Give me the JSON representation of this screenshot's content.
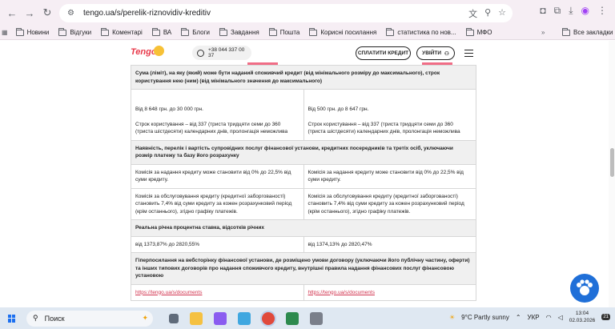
{
  "browser": {
    "url": "tengo.ua/s/perelik-riznovidiv-kreditiv",
    "bookmarks": [
      "Новини",
      "Відгуки",
      "Коментарі",
      "ВА",
      "Блоги",
      "Завдання",
      "Пошта",
      "Корисні посилання",
      "статистика по нов...",
      "МФО"
    ],
    "all_bookmarks": "Все закладки"
  },
  "header": {
    "logo": "Tengo",
    "phone": "+38 044 337 00 37",
    "pay_button": "СПЛАТИТИ КРЕДИТ",
    "login_button": "УВІЙТИ"
  },
  "table": {
    "h1": "Сума (ліміт), на яку (який) може бути наданий споживчий кредит (від мінімального розміру до максимального), строк користування нею (ним) (від мінімального значення до максимального)",
    "r1c1": "Від 8 648 грн. до 30 000 грн.",
    "r1c1b": "Строк користування – від 337 (триста тридцяти семи до 360 (триста шістдесяти) календарних днів, пролонгація неможлива",
    "r1c2": "Від 500 грн. до 8 647 грн.",
    "r1c2b": "Строк користування – від 337 (триста тридцяти семи до 360 (триста шістдесяти) календарних днів, пролонгація неможлива",
    "h2": "Наявність, перелік і вартість супровідних послуг фінансової установи, кредитних посередників та третіх осіб, уключаючи розмір платежу та базу його розрахунку",
    "r2c1": "Комісія за надання кредиту може становити від 0% до 22,5% від суми кредиту.",
    "r2c2": "Комісія за надання кредиту може становити від 0% до 22,5% від суми кредиту.",
    "r3c1": "Комісія за обслуговування кредиту (кредитної заборгованості) становить 7,4% від суми кредиту за кожен розрахунковий період (крім останнього), згідно графіку платежів.",
    "r3c2": "Комісія за обслуговування кредиту (кредитної заборгованості) становить 7,4% від суми кредиту за кожен розрахунковий період (крім останнього), згідно графіку платежів.",
    "h3": "Реальна річна процентна ставка, відсотків річних",
    "r4c1": "від 1373,87% до 2820,55%",
    "r4c2": "від 1374,13% до 2820,47%",
    "h4": "Гіперпосилання на вебсторінку фінансової установи, де розміщено умови договору (уключаючи його публічну частину, оферти) та інших типових договорів про надання споживчого кредиту, внутрішні правила надання фінансових послуг фінансовою установою",
    "link1": "https://tengo.ua/s/documents",
    "link2": "https://tengo.ua/s/documents"
  },
  "taskbar": {
    "search": "Поиск",
    "weather": "9°C  Partly sunny",
    "lang": "УКР",
    "time": "13:04",
    "date": "02.03.2026",
    "notifications": "21"
  }
}
